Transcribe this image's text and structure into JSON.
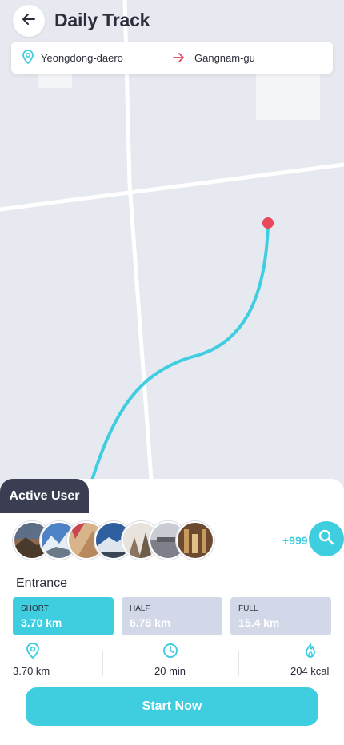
{
  "header": {
    "title": "Daily Track",
    "back_icon": "arrow-left-icon"
  },
  "route": {
    "from": "Yeongdong-daero",
    "to": "Gangnam-gu",
    "from_icon": "location-pin-icon",
    "arrow_icon": "arrow-right-icon"
  },
  "map": {
    "route_color": "#3fcde0",
    "end_marker_color": "#e9475b"
  },
  "active_users": {
    "tab_label": "Active User",
    "avatars": [
      "avatar-1",
      "avatar-2",
      "avatar-3",
      "avatar-4",
      "avatar-5",
      "avatar-6",
      "avatar-7"
    ],
    "more_count": "+999",
    "search_icon": "search-icon"
  },
  "entrance": {
    "title": "Entrance",
    "options": [
      {
        "label": "SHORT",
        "value": "3.70 km",
        "selected": true
      },
      {
        "label": "HALF",
        "value": "6.78 km",
        "selected": false
      },
      {
        "label": "FULL",
        "value": "15.4 km",
        "selected": false
      }
    ]
  },
  "stats": {
    "distance": "3.70 km",
    "duration": "20 min",
    "calories": "204 kcal"
  },
  "cta": {
    "label": "Start Now"
  },
  "colors": {
    "accent": "#3fcde0",
    "dark": "#3b3e52",
    "option_inactive": "#d3d8e8",
    "marker_red": "#e9475b"
  }
}
